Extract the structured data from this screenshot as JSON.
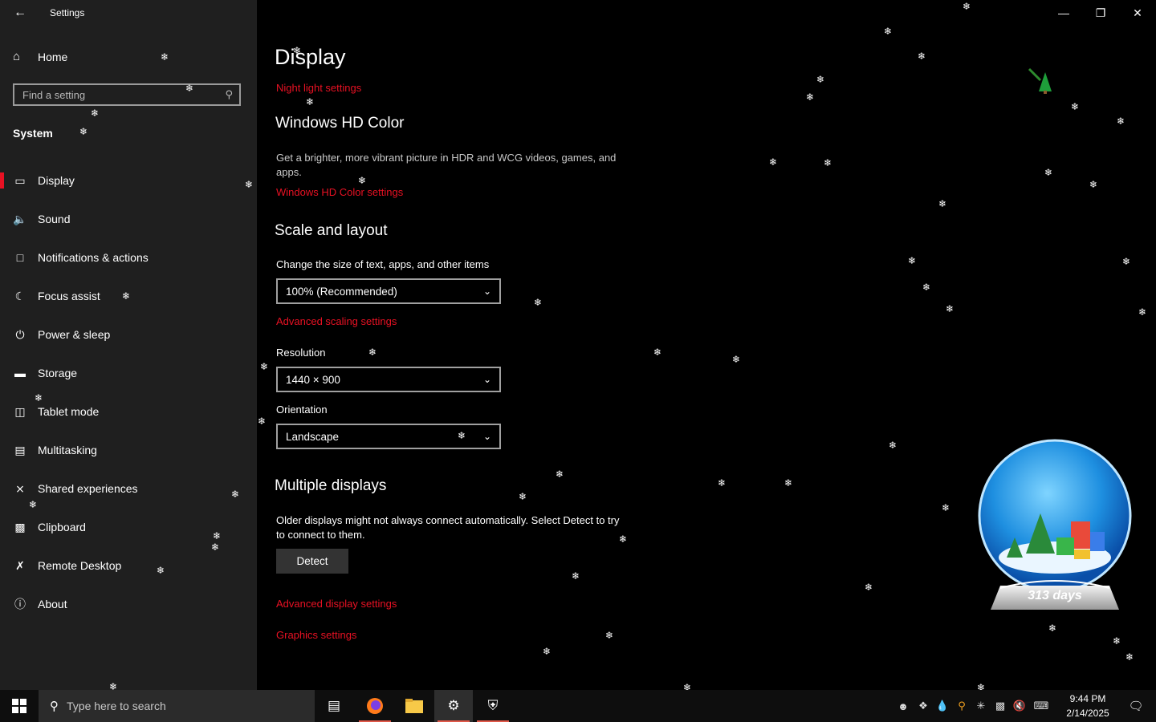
{
  "window": {
    "title": "Settings",
    "back_icon": "back-arrow-icon"
  },
  "sidebar": {
    "home_label": "Home",
    "search_placeholder": "Find a setting",
    "section": "System",
    "items": [
      {
        "label": "Display",
        "icon": "monitor-icon",
        "active": true
      },
      {
        "label": "Sound",
        "icon": "speaker-icon"
      },
      {
        "label": "Notifications & actions",
        "icon": "message-icon"
      },
      {
        "label": "Focus assist",
        "icon": "moon-icon"
      },
      {
        "label": "Power & sleep",
        "icon": "power-icon"
      },
      {
        "label": "Storage",
        "icon": "drive-icon"
      },
      {
        "label": "Tablet mode",
        "icon": "tablet-icon"
      },
      {
        "label": "Multitasking",
        "icon": "multitasking-icon"
      },
      {
        "label": "Shared experiences",
        "icon": "shared-icon"
      },
      {
        "label": "Clipboard",
        "icon": "clipboard-icon"
      },
      {
        "label": "Remote Desktop",
        "icon": "remote-icon"
      },
      {
        "label": "About",
        "icon": "info-icon"
      }
    ]
  },
  "main": {
    "title": "Display",
    "night_light_link": "Night light settings",
    "hd_color": {
      "heading": "Windows HD Color",
      "description": "Get a brighter, more vibrant picture in HDR and WCG videos, games, and apps.",
      "link": "Windows HD Color settings"
    },
    "scale_layout": {
      "heading": "Scale and layout",
      "scale_label": "Change the size of text, apps, and other items",
      "scale_value": "100% (Recommended)",
      "advanced_scaling_link": "Advanced scaling settings",
      "resolution_label": "Resolution",
      "resolution_value": "1440 × 900",
      "orientation_label": "Orientation",
      "orientation_value": "Landscape"
    },
    "multiple_displays": {
      "heading": "Multiple displays",
      "description": "Older displays might not always connect automatically. Select Detect to try to connect to them.",
      "detect_button": "Detect"
    },
    "advanced_display_link": "Advanced display settings",
    "graphics_link": "Graphics settings"
  },
  "desktop_widget": {
    "globe_text": "313 days"
  },
  "taskbar": {
    "search_placeholder": "Type here to search",
    "time": "9:44 PM",
    "date": "2/14/2025"
  },
  "colors": {
    "accent": "#e81123",
    "sidebar_bg": "#1f1f1f",
    "background": "#000000"
  }
}
